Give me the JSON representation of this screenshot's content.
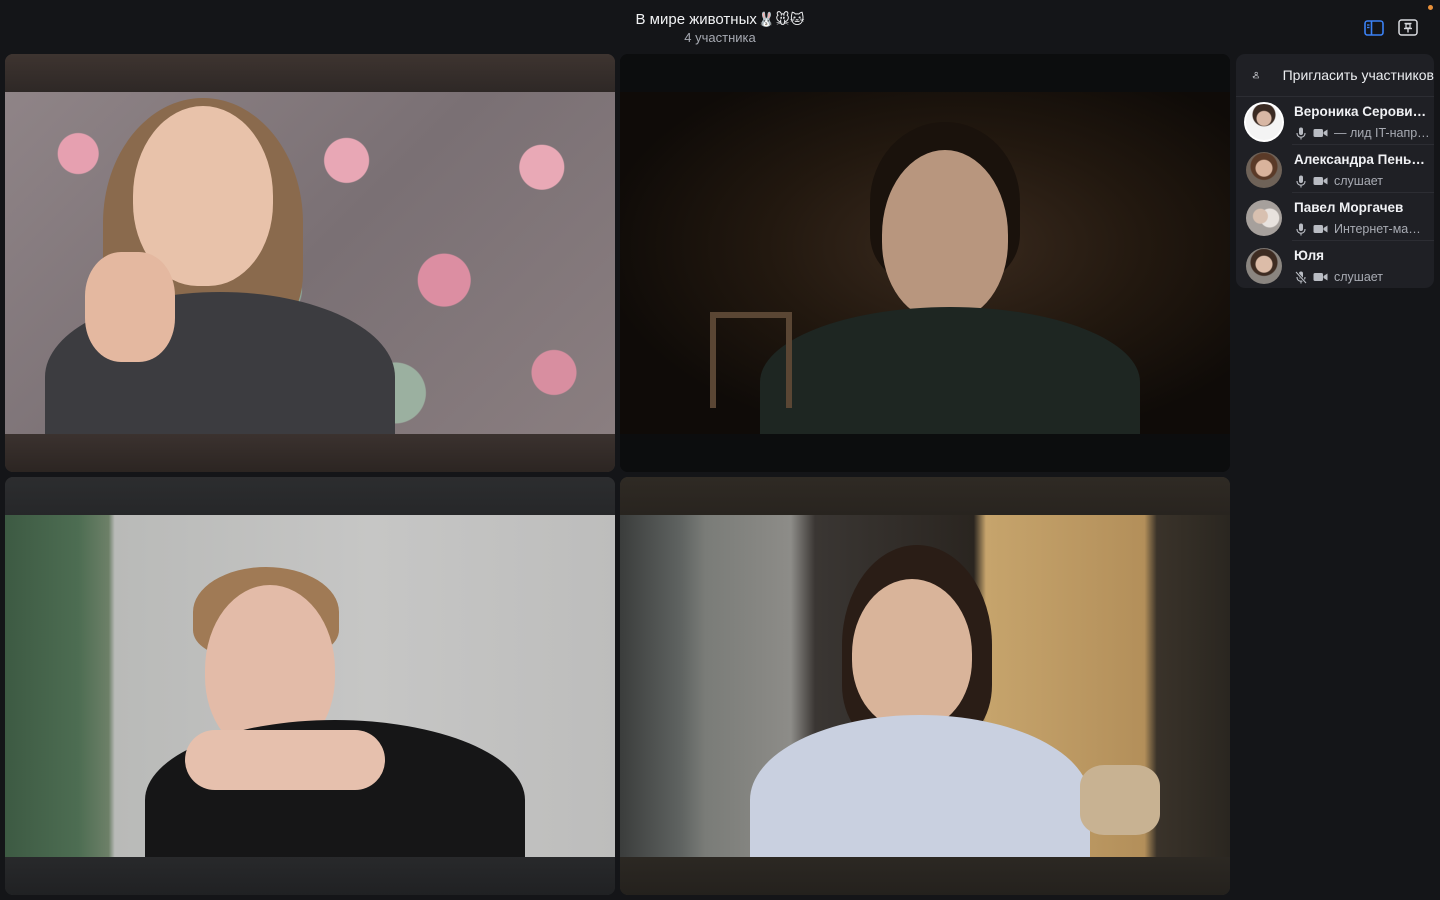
{
  "header": {
    "title": "В мире животных",
    "title_emojis": "🐰🐭🐱",
    "participants_count": "4 участника"
  },
  "icons": {
    "sidebar_toggle": "sidebar-toggle-icon",
    "pin": "pin-icon",
    "invite": "add-person-icon",
    "mic": "microphone-icon",
    "mic_muted": "microphone-muted-icon",
    "camera": "camera-icon"
  },
  "colors": {
    "background": "#141518",
    "panel": "#1f2025",
    "accent_blue": "#3b82f6",
    "notification_dot": "#e8903a"
  },
  "panel": {
    "invite_label": "Пригласить участников",
    "participants": [
      {
        "name": "Вероника Серови…",
        "status": "— лид IT-напр…",
        "mic": "on",
        "camera": "on",
        "active": true
      },
      {
        "name": "Александра Пеньк…",
        "status": "слушает",
        "mic": "on",
        "camera": "on",
        "active": false
      },
      {
        "name": "Павел Моргачев",
        "status": "Интернет-ма…",
        "mic": "on",
        "camera": "on",
        "active": false
      },
      {
        "name": "Юля",
        "status": "слушает",
        "mic": "muted",
        "camera": "on",
        "active": false
      }
    ]
  }
}
